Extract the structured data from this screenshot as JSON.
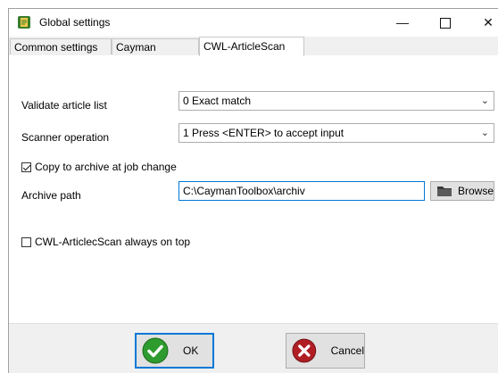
{
  "window": {
    "title": "Global settings",
    "controls": {
      "minimize": "—",
      "close": "✕"
    }
  },
  "tabs": [
    {
      "label": "Common settings",
      "active": false
    },
    {
      "label": "Cayman settings",
      "active": false
    },
    {
      "label": "CWL-ArticleScan",
      "active": true
    }
  ],
  "form": {
    "validate_label": "Validate article list",
    "validate_value": "0 Exact match",
    "scanner_label": "Scanner operation",
    "scanner_value": "1 Press <ENTER> to accept input",
    "copy_archive_label": "Copy to archive at job change",
    "copy_archive_checked": true,
    "archive_path_label": "Archive path",
    "archive_path_value": "C:\\CaymanToolbox\\archiv",
    "browse_label": "Browse",
    "always_on_top_label": "CWL-ArticlecScan always on top",
    "always_on_top_checked": false
  },
  "buttons": {
    "ok_label": "OK",
    "cancel_label": "Cancel"
  },
  "colors": {
    "accent": "#0078d7",
    "ok_green": "#2e9b2e",
    "cancel_red": "#b01e24"
  }
}
